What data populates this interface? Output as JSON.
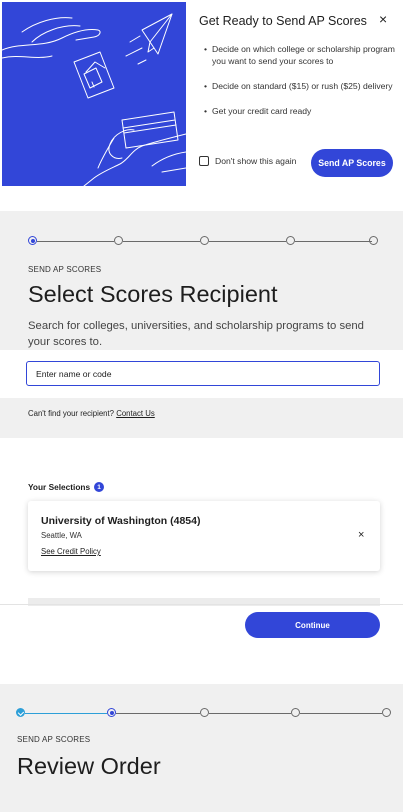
{
  "modal": {
    "title": "Get Ready to Send AP Scores",
    "close_glyph": "×",
    "items": [
      "Decide on which college or scholarship program you want to send your scores to",
      "Decide on standard ($15) or rush ($25) delivery",
      "Get your credit card ready"
    ],
    "dont_show_label": "Don't show this again",
    "send_button": "Send AP Scores",
    "illustration_icon": "hands-paper-plane-credit-card-illustration"
  },
  "step_select": {
    "eyebrow": "SEND AP SCORES",
    "title": "Select Scores Recipient",
    "description": "Search for colleges, universities, and scholarship programs to send your scores to.",
    "search_placeholder": "Enter name or code",
    "cant_find_text": "Can't find your recipient?",
    "contact_link": "Contact Us"
  },
  "selections": {
    "label": "Your Selections",
    "count": "1",
    "items": [
      {
        "name": "University of Washington (4854)",
        "location": "Seattle, WA",
        "policy_link": "See Credit Policy"
      }
    ],
    "continue_button": "Continue"
  },
  "step_review": {
    "eyebrow": "SEND AP SCORES",
    "title": "Review Order"
  },
  "colors": {
    "brand_blue": "#3246d8",
    "done_blue": "#2d9fd8",
    "panel_gray": "#f0f0f0"
  }
}
